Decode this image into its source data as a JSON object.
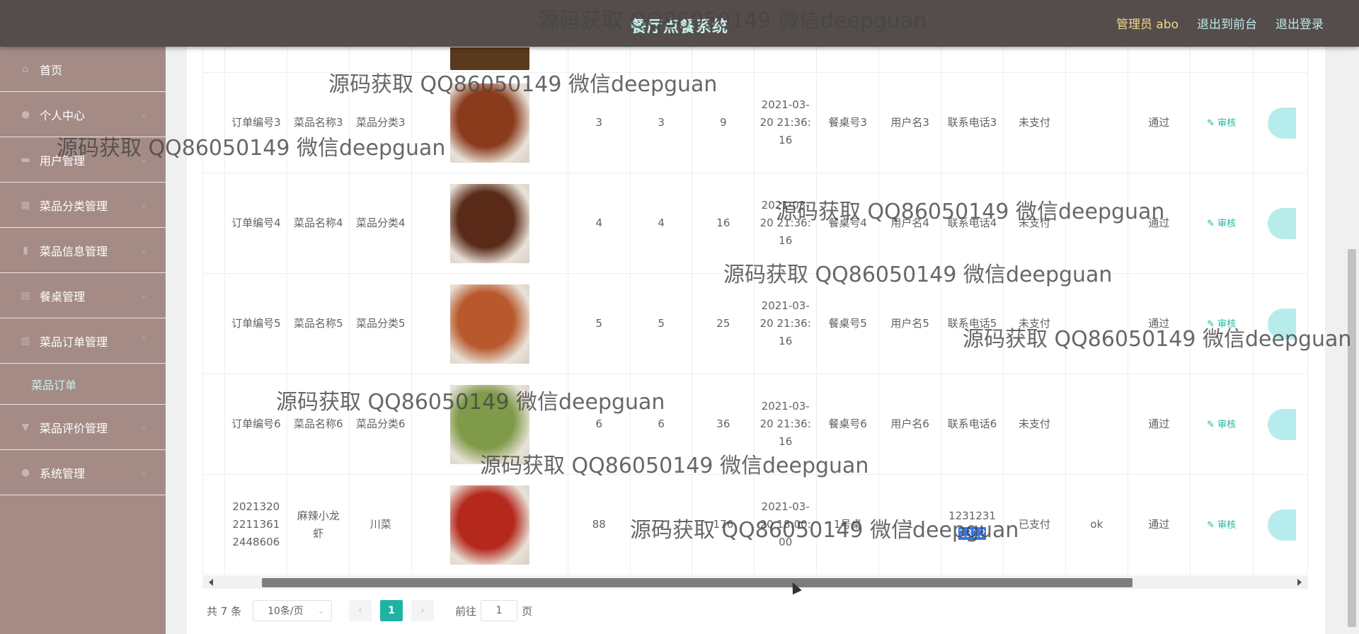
{
  "header": {
    "title": "餐厅点餐系统",
    "admin": "管理员 abo",
    "links": [
      "退出到前台",
      "退出登录"
    ]
  },
  "sidebar": {
    "items": [
      {
        "label": "首页",
        "icon": "home-icon"
      },
      {
        "label": "个人中心",
        "icon": "user-icon"
      },
      {
        "label": "用户管理",
        "icon": "users-icon"
      },
      {
        "label": "菜品分类管理",
        "icon": "grid-icon"
      },
      {
        "label": "菜品信息管理",
        "icon": "doc-icon"
      },
      {
        "label": "餐桌管理",
        "icon": "table-icon"
      },
      {
        "label": "菜品订单管理",
        "icon": "chart-icon"
      }
    ],
    "submenu": "菜品订单",
    "items_after": [
      {
        "label": "菜品评价管理",
        "icon": "comment-icon"
      },
      {
        "label": "系统管理",
        "icon": "settings-icon"
      }
    ]
  },
  "rows": [
    {
      "order": "订单编号3",
      "name": "菜品名称3",
      "category": "菜品分类3",
      "price": "3",
      "qty": "3",
      "total": "9",
      "time": "2021-03-20 21:36:16",
      "table": "餐桌号3",
      "user": "用户名3",
      "phone": "联系电话3",
      "paid": "未支付",
      "reply": "",
      "status": "通过",
      "action": "审核",
      "food": "#8a3b1c"
    },
    {
      "order": "订单编号4",
      "name": "菜品名称4",
      "category": "菜品分类4",
      "price": "4",
      "qty": "4",
      "total": "16",
      "time": "2021-03-20 21:36:16",
      "table": "餐桌号4",
      "user": "用户名4",
      "phone": "联系电话4",
      "paid": "未支付",
      "reply": "",
      "status": "通过",
      "action": "审核",
      "food": "#5a2a18"
    },
    {
      "order": "订单编号5",
      "name": "菜品名称5",
      "category": "菜品分类5",
      "price": "5",
      "qty": "5",
      "total": "25",
      "time": "2021-03-20 21:36:16",
      "table": "餐桌号5",
      "user": "用户名5",
      "phone": "联系电话5",
      "paid": "未支付",
      "reply": "",
      "status": "通过",
      "action": "审核",
      "food": "#b8582c"
    },
    {
      "order": "订单编号6",
      "name": "菜品名称6",
      "category": "菜品分类6",
      "price": "6",
      "qty": "6",
      "total": "36",
      "time": "2021-03-20 21:36:16",
      "table": "餐桌号6",
      "user": "用户名6",
      "phone": "联系电话6",
      "paid": "未支付",
      "reply": "",
      "status": "通过",
      "action": "审核",
      "food": "#7f9a48"
    },
    {
      "order": "20213202211361 2448606",
      "name": "麻辣小龙虾",
      "category": "川菜",
      "price": "88",
      "qty": "2",
      "total": "176",
      "time": "2021-03-20 18:00:00",
      "table": "1号桌",
      "user": "1",
      "phone_main": "1231231",
      "phone_sel": "2312",
      "paid": "已支付",
      "reply": "ok",
      "status": "通过",
      "action": "审核",
      "food": "#b5281c"
    }
  ],
  "pager": {
    "total": "共 7 条",
    "size": "10条/页",
    "current": "1",
    "goto_label": "前往",
    "goto_value": "1",
    "page_suffix": "页",
    "prev": "‹",
    "next": "›"
  },
  "watermark": "源码获取 QQ86050149 微信deepguan"
}
